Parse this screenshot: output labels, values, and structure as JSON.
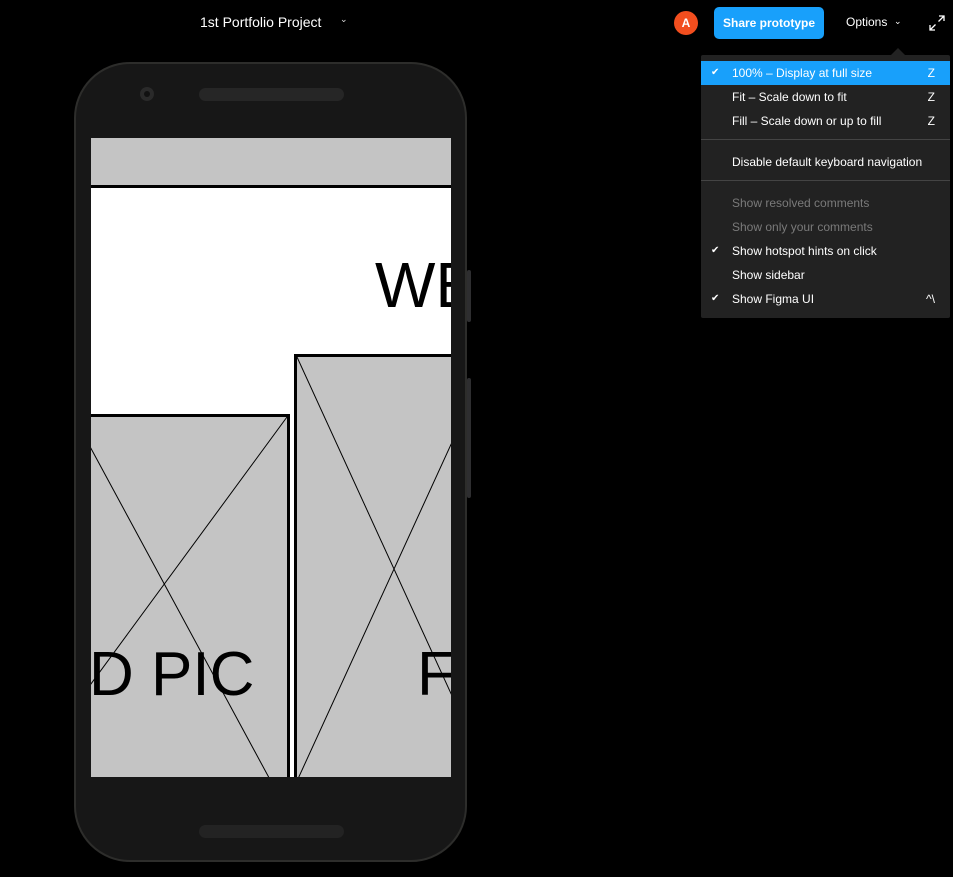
{
  "header": {
    "file_title": "1st Portfolio Project",
    "title_chevron": "⌄",
    "avatar_initial": "A",
    "avatar_color": "#f24e1e",
    "share_label": "Share prototype",
    "share_color": "#18a0fb",
    "options_label": "Options",
    "options_chevron": "⌄",
    "expand_icon": "expand-icon"
  },
  "options_menu": {
    "groups": [
      {
        "items": [
          {
            "label": "100% – Display at full size",
            "shortcut": "Z",
            "checked": true,
            "active": true,
            "disabled": false
          },
          {
            "label": "Fit – Scale down to fit",
            "shortcut": "Z",
            "checked": false,
            "active": false,
            "disabled": false
          },
          {
            "label": "Fill – Scale down or up to fill",
            "shortcut": "Z",
            "checked": false,
            "active": false,
            "disabled": false
          }
        ]
      },
      {
        "items": [
          {
            "label": "Disable default keyboard navigation",
            "shortcut": "",
            "checked": false,
            "active": false,
            "disabled": false
          }
        ]
      },
      {
        "items": [
          {
            "label": "Show resolved comments",
            "shortcut": "",
            "checked": false,
            "active": false,
            "disabled": true
          },
          {
            "label": "Show only your comments",
            "shortcut": "",
            "checked": false,
            "active": false,
            "disabled": true
          },
          {
            "label": "Show hotspot hints on click",
            "shortcut": "",
            "checked": true,
            "active": false,
            "disabled": false
          },
          {
            "label": "Show sidebar",
            "shortcut": "",
            "checked": false,
            "active": false,
            "disabled": false
          },
          {
            "label": "Show Figma UI",
            "shortcut": "^\\",
            "checked": true,
            "active": false,
            "disabled": false
          }
        ]
      }
    ],
    "check_glyph": "✔"
  },
  "prototype": {
    "device": "Android phone frame",
    "hero_text": "WE",
    "left_card_text": "D PIC",
    "right_card_text": "F",
    "placeholder_color": "#c4c4c4"
  }
}
